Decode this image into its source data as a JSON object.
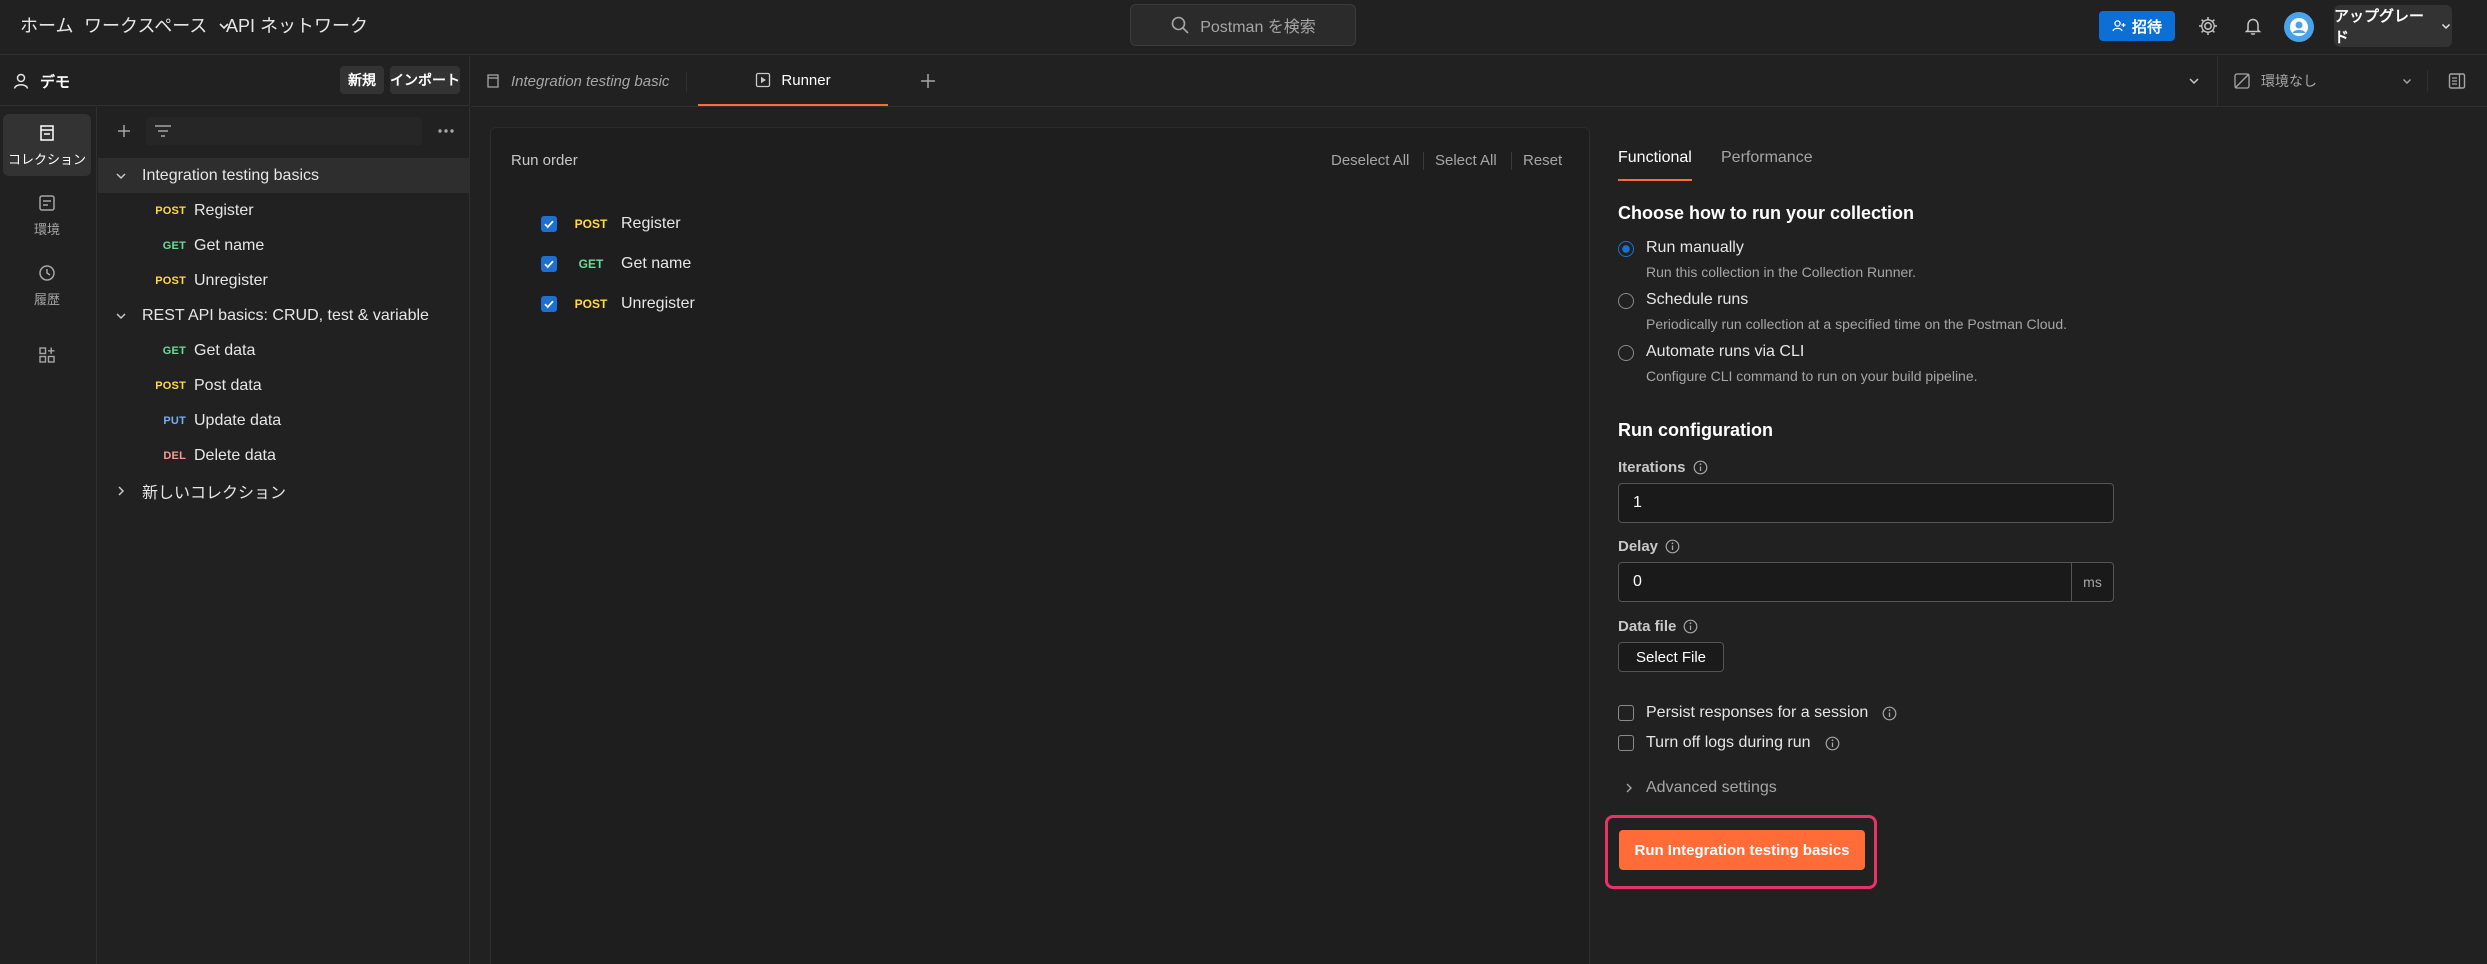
{
  "topnav": {
    "home": "ホーム",
    "workspaces": "ワークスペース",
    "api_network": "API ネットワーク",
    "search_placeholder": "Postman を検索",
    "invite": "招待",
    "upgrade": "アップグレード"
  },
  "workspace": {
    "name": "デモ",
    "new_label": "新規",
    "import_label": "インポート"
  },
  "rail": {
    "collections": "コレクション",
    "environments": "環境",
    "history": "履歴"
  },
  "tree": {
    "collections": [
      {
        "name": "Integration testing basics",
        "expanded": true,
        "requests": [
          {
            "method": "POST",
            "name": "Register"
          },
          {
            "method": "GET",
            "name": "Get name"
          },
          {
            "method": "POST",
            "name": "Unregister"
          }
        ]
      },
      {
        "name": "REST API basics: CRUD, test & variable",
        "expanded": true,
        "requests": [
          {
            "method": "GET",
            "name": "Get data"
          },
          {
            "method": "POST",
            "name": "Post data"
          },
          {
            "method": "PUT",
            "name": "Update data"
          },
          {
            "method": "DEL",
            "name": "Delete data"
          }
        ]
      },
      {
        "name": "新しいコレクション",
        "expanded": false,
        "requests": []
      }
    ]
  },
  "tabs": {
    "integration": "Integration testing basic",
    "runner": "Runner",
    "environment": "環境なし"
  },
  "run_order": {
    "title": "Run order",
    "deselect_all": "Deselect All",
    "select_all": "Select All",
    "reset": "Reset",
    "items": [
      {
        "method": "POST",
        "name": "Register",
        "checked": true
      },
      {
        "method": "GET",
        "name": "Get name",
        "checked": true
      },
      {
        "method": "POST",
        "name": "Unregister",
        "checked": true
      }
    ]
  },
  "config": {
    "tab_functional": "Functional",
    "tab_performance": "Performance",
    "heading_choose": "Choose how to run your collection",
    "options": [
      {
        "label": "Run manually",
        "desc": "Run this collection in the Collection Runner.",
        "selected": true
      },
      {
        "label": "Schedule runs",
        "desc": "Periodically run collection at a specified time on the Postman Cloud.",
        "selected": false
      },
      {
        "label": "Automate runs via CLI",
        "desc": "Configure CLI command to run on your build pipeline.",
        "selected": false
      }
    ],
    "heading_run_config": "Run configuration",
    "iterations_label": "Iterations",
    "iterations_value": "1",
    "delay_label": "Delay",
    "delay_value": "0",
    "delay_unit": "ms",
    "data_file_label": "Data file",
    "select_file": "Select File",
    "persist_responses": "Persist responses for a session",
    "turn_off_logs": "Turn off logs during run",
    "advanced_settings": "Advanced settings",
    "run_button": "Run Integration testing basics"
  },
  "colors": {
    "accent": "#ff6c37",
    "primary_blue": "#0b6fd6",
    "highlight_border": "#e8336a",
    "post": "#ffd84a",
    "get": "#6bdd9a",
    "put": "#74aef6",
    "del": "#f79a8e"
  }
}
